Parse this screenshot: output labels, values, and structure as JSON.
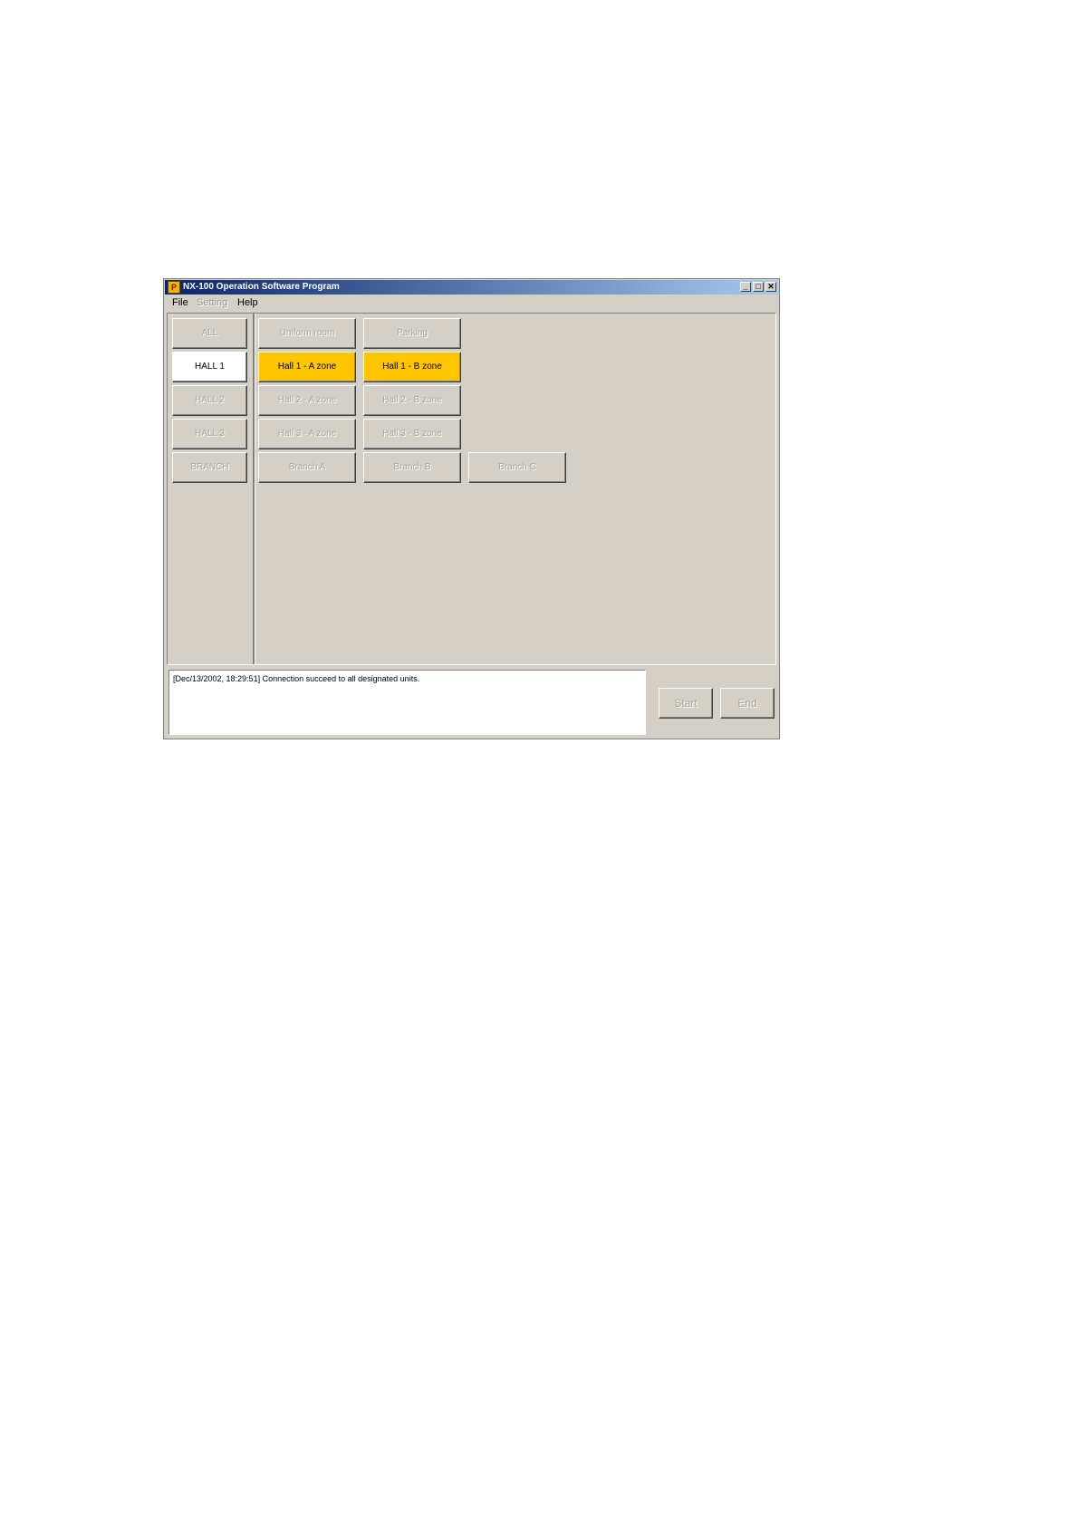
{
  "window": {
    "title": "NX-100 Operation Software Program",
    "app_icon_label": "P",
    "controls": {
      "minimize": "_",
      "maximize": "□",
      "close": "✕"
    }
  },
  "menu": {
    "file": "File",
    "setting": "Setting",
    "help": "Help"
  },
  "groups": [
    "ALL",
    "HALL 1",
    "HALL 2",
    "HALL 3",
    "BRANCH"
  ],
  "selected_group": "HALL 1",
  "zones": {
    "row1": [
      "Uniform room",
      "Parking"
    ],
    "row2": [
      "Hall 1 - A zone",
      "Hall 1 - B zone"
    ],
    "row3": [
      "Hall 2 - A zone",
      "Hall 2 - B zone"
    ],
    "row4": [
      "Hall 3 - A zone",
      "Hall 3 - B zone"
    ],
    "row5": [
      "Branch A",
      "Branch B",
      "Branch C"
    ]
  },
  "active_zone_color": "#ffc600",
  "log": {
    "message": "[Dec/13/2002, 18:29:51] Connection succeed to all designated units."
  },
  "actions": {
    "start": "Start",
    "end": "End"
  }
}
